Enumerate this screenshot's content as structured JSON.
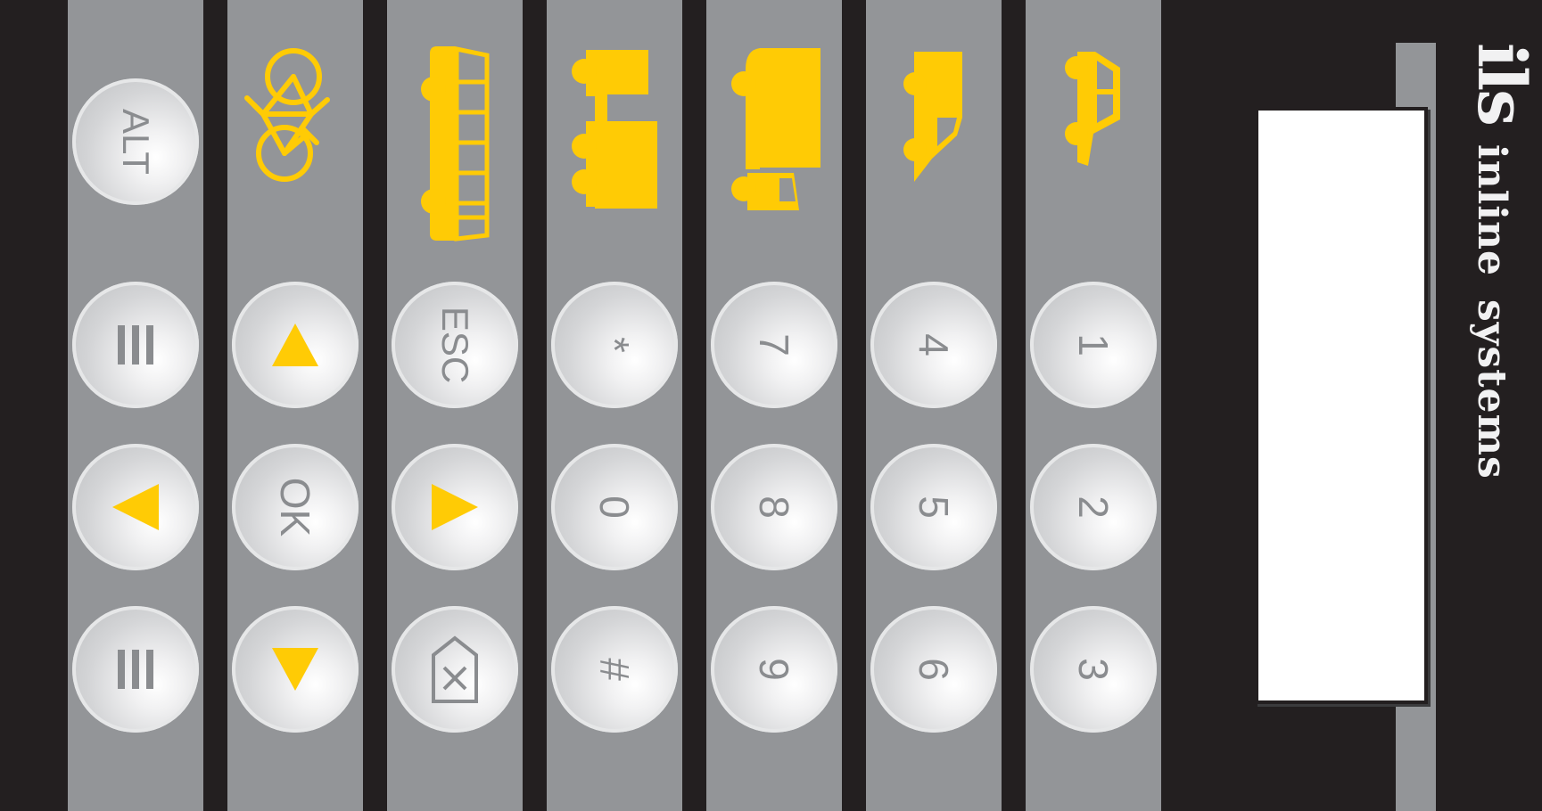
{
  "brand": {
    "logo": "ils",
    "name_word1": "inline",
    "name_word2": "systems"
  },
  "colors": {
    "background": "#231f20",
    "column": "#939598",
    "accent": "#ffcb05",
    "key_text": "#8a8c8f",
    "display": "#ffffff"
  },
  "vehicles": [
    {
      "name": "bicycle-icon"
    },
    {
      "name": "bus-icon"
    },
    {
      "name": "articulated-truck-icon"
    },
    {
      "name": "truck-icon"
    },
    {
      "name": "van-icon"
    },
    {
      "name": "car-icon"
    }
  ],
  "keys": {
    "alt": "ALT",
    "menu_top": "menu-lines-icon",
    "left": "arrow-left-icon",
    "menu_bottom": "menu-lines-icon",
    "up": "arrow-up-icon",
    "ok": "OK",
    "down": "arrow-down-icon",
    "esc": "ESC",
    "right": "arrow-right-icon",
    "delete": "delete-icon",
    "star": "*",
    "zero": "0",
    "hash": "#",
    "seven": "7",
    "eight": "8",
    "nine": "9",
    "four": "4",
    "five": "5",
    "six": "6",
    "one": "1",
    "two": "2",
    "three": "3"
  }
}
